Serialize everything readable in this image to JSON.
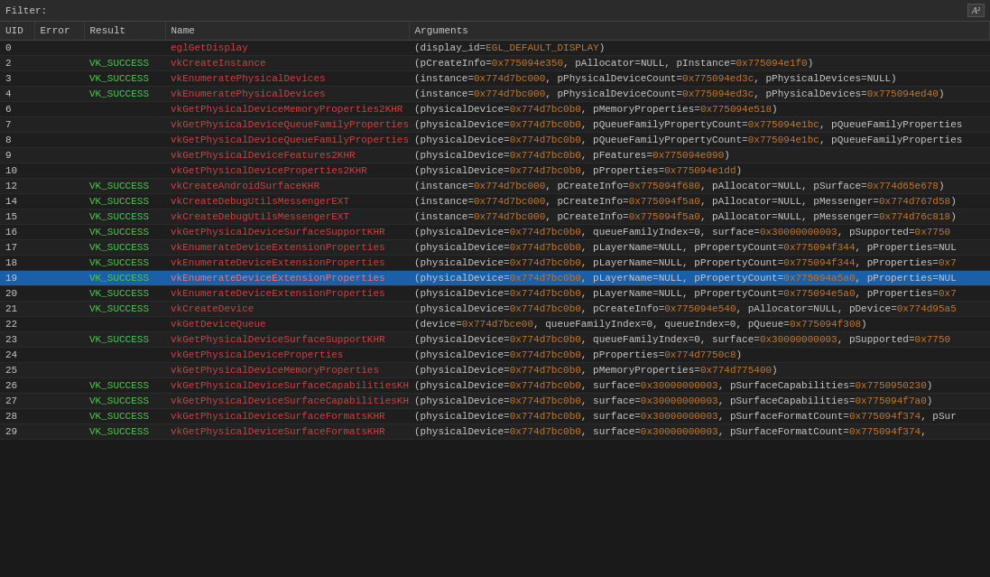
{
  "filter": {
    "label": "Filter:",
    "value": "",
    "az_label": "A²"
  },
  "columns": [
    "UID",
    "Error",
    "Result",
    "Name",
    "Arguments"
  ],
  "rows": [
    {
      "uid": "0",
      "error": "",
      "result": "",
      "name": "eglGetDisplay",
      "name_color": "egl",
      "args": "(display_id=EGL_DEFAULT_DISPLAY)",
      "selected": false
    },
    {
      "uid": "2",
      "error": "",
      "result": "VK_SUCCESS",
      "name": "vkCreateInstance",
      "args": "(pCreateInfo=0x775094e350, pAllocator=NULL, pInstance=0x775094e1f0)",
      "selected": false
    },
    {
      "uid": "3",
      "error": "",
      "result": "VK_SUCCESS",
      "name": "vkEnumeratePhysicalDevices",
      "args": "(instance=0x774d7bc000, pPhysicalDeviceCount=0x775094ed3c, pPhysicalDevices=NULL)",
      "selected": false
    },
    {
      "uid": "4",
      "error": "",
      "result": "VK_SUCCESS",
      "name": "vkEnumeratePhysicalDevices",
      "args": "(instance=0x774d7bc000, pPhysicalDeviceCount=0x775094ed3c, pPhysicalDevices=0x775094ed40)",
      "selected": false
    },
    {
      "uid": "6",
      "error": "",
      "result": "",
      "name": "vkGetPhysicalDeviceMemoryProperties2KHR",
      "args": "(physicalDevice=0x774d7bc0b0, pMemoryProperties=0x775094e518)",
      "selected": false
    },
    {
      "uid": "7",
      "error": "",
      "result": "",
      "name": "vkGetPhysicalDeviceQueueFamilyProperties2KHR",
      "args": "(physicalDevice=0x774d7bc0b0, pQueueFamilyPropertyCount=0x775094e1bc, pQueueFamilyProperties",
      "selected": false
    },
    {
      "uid": "8",
      "error": "",
      "result": "",
      "name": "vkGetPhysicalDeviceQueueFamilyProperties2KHR",
      "args": "(physicalDevice=0x774d7bc0b0, pQueueFamilyPropertyCount=0x775094e1bc, pQueueFamilyProperties",
      "selected": false
    },
    {
      "uid": "9",
      "error": "",
      "result": "",
      "name": "vkGetPhysicalDeviceFeatures2KHR",
      "args": "(physicalDevice=0x774d7bc0b0, pFeatures=0x775094e090)",
      "selected": false
    },
    {
      "uid": "10",
      "error": "",
      "result": "",
      "name": "vkGetPhysicalDeviceProperties2KHR",
      "args": "(physicalDevice=0x774d7bc0b0, pProperties=0x775094e1dd)",
      "selected": false
    },
    {
      "uid": "12",
      "error": "",
      "result": "VK_SUCCESS",
      "name": "vkCreateAndroidSurfaceKHR",
      "args": "(instance=0x774d7bc000, pCreateInfo=0x775094f680, pAllocator=NULL, pSurface=0x774d65e678)",
      "selected": false
    },
    {
      "uid": "14",
      "error": "",
      "result": "VK_SUCCESS",
      "name": "vkCreateDebugUtilsMessengerEXT",
      "args": "(instance=0x774d7bc000, pCreateInfo=0x775094f5a0, pAllocator=NULL, pMessenger=0x774d767d58)",
      "selected": false
    },
    {
      "uid": "15",
      "error": "",
      "result": "VK_SUCCESS",
      "name": "vkCreateDebugUtilsMessengerEXT",
      "args": "(instance=0x774d7bc000, pCreateInfo=0x775094f5a0, pAllocator=NULL, pMessenger=0x774d76c818)",
      "selected": false
    },
    {
      "uid": "16",
      "error": "",
      "result": "VK_SUCCESS",
      "name": "vkGetPhysicalDeviceSurfaceSupportKHR",
      "args": "(physicalDevice=0x774d7bc0b0, queueFamilyIndex=0, surface=0x30000000003, pSupported=0x7750",
      "selected": false
    },
    {
      "uid": "17",
      "error": "",
      "result": "VK_SUCCESS",
      "name": "vkEnumerateDeviceExtensionProperties",
      "args": "(physicalDevice=0x774d7bc0b0, pLayerName=NULL, pPropertyCount=0x775094f344, pProperties=NUL",
      "selected": false
    },
    {
      "uid": "18",
      "error": "",
      "result": "VK_SUCCESS",
      "name": "vkEnumerateDeviceExtensionProperties",
      "args": "(physicalDevice=0x774d7bc0b0, pLayerName=NULL, pPropertyCount=0x775094f344, pProperties=0x7",
      "selected": false
    },
    {
      "uid": "19",
      "error": "",
      "result": "VK_SUCCESS",
      "name": "vkEnumerateDeviceExtensionProperties",
      "args": "(physicalDevice=0x774d7bc0b0, pLayerName=NULL, pPropertyCount=0x775094a5a0, pProperties=NUL",
      "selected": true
    },
    {
      "uid": "20",
      "error": "",
      "result": "VK_SUCCESS",
      "name": "vkEnumerateDeviceExtensionProperties",
      "args": "(physicalDevice=0x774d7bc0b0, pLayerName=NULL, pPropertyCount=0x775094e5a0, pProperties=0x7",
      "selected": false
    },
    {
      "uid": "21",
      "error": "",
      "result": "VK_SUCCESS",
      "name": "vkCreateDevice",
      "args": "(physicalDevice=0x774d7bc0b0, pCreateInfo=0x775094e540, pAllocator=NULL, pDevice=0x774d95a5",
      "selected": false
    },
    {
      "uid": "22",
      "error": "",
      "result": "",
      "name": "vkGetDeviceQueue",
      "args": "(device=0x774d7bce00, queueFamilyIndex=0, queueIndex=0, pQueue=0x775094f308)",
      "selected": false
    },
    {
      "uid": "23",
      "error": "",
      "result": "VK_SUCCESS",
      "name": "vkGetPhysicalDeviceSurfaceSupportKHR",
      "args": "(physicalDevice=0x774d7bc0b0, queueFamilyIndex=0, surface=0x30000000003, pSupported=0x7750",
      "selected": false
    },
    {
      "uid": "24",
      "error": "",
      "result": "",
      "name": "vkGetPhysicalDeviceProperties",
      "args": "(physicalDevice=0x774d7bc0b0, pProperties=0x774d7750c8)",
      "selected": false
    },
    {
      "uid": "25",
      "error": "",
      "result": "",
      "name": "vkGetPhysicalDeviceMemoryProperties",
      "args": "(physicalDevice=0x774d7bc0b0, pMemoryProperties=0x774d775400)",
      "selected": false
    },
    {
      "uid": "26",
      "error": "",
      "result": "VK_SUCCESS",
      "name": "vkGetPhysicalDeviceSurfaceCapabilitiesKHR",
      "args": "(physicalDevice=0x774d7bc0b0, surface=0x30000000003, pSurfaceCapabilities=0x7750950230)",
      "selected": false
    },
    {
      "uid": "27",
      "error": "",
      "result": "VK_SUCCESS",
      "name": "vkGetPhysicalDeviceSurfaceCapabilitiesKHR",
      "args": "(physicalDevice=0x774d7bc0b0, surface=0x30000000003, pSurfaceCapabilities=0x775094f7a0)",
      "selected": false
    },
    {
      "uid": "28",
      "error": "",
      "result": "VK_SUCCESS",
      "name": "vkGetPhysicalDeviceSurfaceFormatsKHR",
      "args": "(physicalDevice=0x774d7bc0b0, surface=0x30000000003, pSurfaceFormatCount=0x775094f374, pSur",
      "selected": false
    },
    {
      "uid": "29",
      "error": "",
      "result": "VK_SUCCESS",
      "name": "vkGetPhysicalDeviceSurfaceFormatsKHR",
      "args": "(physicalDevice=0x774d7bc0b0, surface=0x30000000003, pSurfaceFormatCount=0x775094f374,",
      "selected": false
    }
  ]
}
